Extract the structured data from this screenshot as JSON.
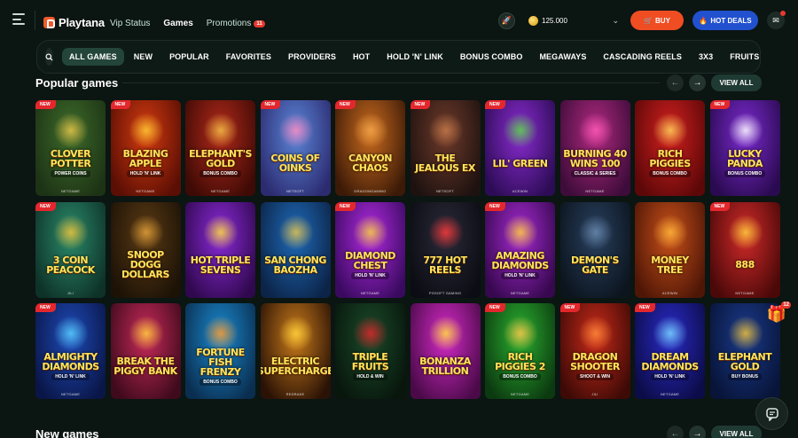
{
  "header": {
    "logo_text": "Playtana",
    "nav": [
      {
        "label": "Vip Status"
      },
      {
        "label": "Games"
      },
      {
        "label": "Promotions",
        "badge": "11"
      }
    ],
    "balance": "125.000",
    "buy_label": "BUY",
    "deals_label": "HOT DEALS",
    "icons": {
      "menu": "hamburger-menu-icon",
      "rocket": "rocket-icon",
      "mail": "mail-icon",
      "chevron": "chevron-down-icon"
    }
  },
  "categories": [
    "ALL GAMES",
    "NEW",
    "POPULAR",
    "FAVORITES",
    "PROVIDERS",
    "HOT",
    "HOLD 'N' LINK",
    "BONUS COMBO",
    "MEGAWAYS",
    "CASCADING REELS",
    "3X3",
    "FRUITS"
  ],
  "popular": {
    "title": "Popular games",
    "view_all": "VIEW ALL"
  },
  "new_games": {
    "title": "New games",
    "view_all": "VIEW ALL"
  },
  "new_badge": "NEW",
  "games": [
    {
      "title": "CLOVER POTTER",
      "sub": "POWER COINS",
      "provider": "NETGAME",
      "new": true,
      "bg1": "#3d6b2a",
      "bg2": "#1d3315",
      "blob": "#e9c64a"
    },
    {
      "title": "BLAZING APPLE",
      "sub": "HOLD 'N' LINK",
      "provider": "NETGAME",
      "new": true,
      "bg1": "#d43b10",
      "bg2": "#5a0e04",
      "blob": "#ffcc33"
    },
    {
      "title": "ELEPHANT'S GOLD",
      "sub": "BONUS COMBO",
      "provider": "NETGAME",
      "new": false,
      "bg1": "#b1291a",
      "bg2": "#3e0a05",
      "blob": "#f3c048"
    },
    {
      "title": "COINS OF OINKS",
      "sub": "",
      "provider": "NETSOFT",
      "new": true,
      "bg1": "#5b86d8",
      "bg2": "#2c2b70",
      "blob": "#ff8ac2"
    },
    {
      "title": "CANYON CHAOS",
      "sub": "",
      "provider": "DRAGONGAMING",
      "new": true,
      "bg1": "#c86a1e",
      "bg2": "#3c1a07",
      "blob": "#f2a64a"
    },
    {
      "title": "THE JEALOUS EX",
      "sub": "",
      "provider": "NETSOFT",
      "new": true,
      "bg1": "#6e3a2a",
      "bg2": "#1e1210",
      "blob": "#c47a4a"
    },
    {
      "title": "LIL' GREEN",
      "sub": "",
      "provider": "ACEWIN",
      "new": true,
      "bg1": "#8a2bd0",
      "bg2": "#2c0c55",
      "blob": "#59d845"
    },
    {
      "title": "BURNING 40 WINS 100",
      "sub": "CLASSIC & SERIES",
      "provider": "NETGAME",
      "new": false,
      "bg1": "#b12a80",
      "bg2": "#3e0c3a",
      "blob": "#ff5ab8"
    },
    {
      "title": "RICH PIGGIES",
      "sub": "BONUS COMBO",
      "provider": "",
      "new": false,
      "bg1": "#d2201f",
      "bg2": "#5c0708",
      "blob": "#ffd45a"
    },
    {
      "title": "LUCKY PANDA",
      "sub": "BONUS COMBO",
      "provider": "",
      "new": true,
      "bg1": "#7b2ad0",
      "bg2": "#2a0a50",
      "blob": "#ffffff"
    },
    {
      "title": "3 COIN PEACOCK",
      "sub": "",
      "provider": "JILI",
      "new": true,
      "bg1": "#2a8a6a",
      "bg2": "#0e3228",
      "blob": "#f0c23a"
    },
    {
      "title": "SNOOP DOGG DOLLARS",
      "sub": "",
      "provider": "",
      "new": false,
      "bg1": "#5a3a14",
      "bg2": "#1c1206",
      "blob": "#e5a23a"
    },
    {
      "title": "HOT TRIPLE SEVENS",
      "sub": "",
      "provider": "",
      "new": false,
      "bg1": "#8a2ad8",
      "bg2": "#30084e",
      "blob": "#ffde3a"
    },
    {
      "title": "SAN CHONG BAOZHA",
      "sub": "",
      "provider": "",
      "new": false,
      "bg1": "#1e6ab8",
      "bg2": "#0c2448",
      "blob": "#e6c24a"
    },
    {
      "title": "DIAMOND CHEST",
      "sub": "HOLD 'N' LINK",
      "provider": "NETGAME",
      "new": true,
      "bg1": "#b02ae0",
      "bg2": "#3a0a60",
      "blob": "#f7d23a"
    },
    {
      "title": "777 HOT REELS",
      "sub": "",
      "provider": "PGSOFT GAMING",
      "new": false,
      "bg1": "#2a2a38",
      "bg2": "#0c0c14",
      "blob": "#ff3a3a"
    },
    {
      "title": "AMAZING DIAMONDS",
      "sub": "HOLD 'N' LINK",
      "provider": "NETGAME",
      "new": true,
      "bg1": "#a42ad0",
      "bg2": "#36084e",
      "blob": "#ffcf3a"
    },
    {
      "title": "DEMON'S GATE",
      "sub": "",
      "provider": "",
      "new": false,
      "bg1": "#28405e",
      "bg2": "#0c141e",
      "blob": "#6a8ab0"
    },
    {
      "title": "MONEY TREE",
      "sub": "",
      "provider": "ACEWIN",
      "new": false,
      "bg1": "#c8501a",
      "bg2": "#4e1606",
      "blob": "#ffb63a"
    },
    {
      "title": "888",
      "sub": "",
      "provider": "NETGAME",
      "new": true,
      "bg1": "#d02a2a",
      "bg2": "#4a0808",
      "blob": "#ffd03a"
    },
    {
      "title": "ALMIGHTY DIAMONDS",
      "sub": "HOLD 'N' LINK",
      "provider": "NETGAME",
      "new": true,
      "bg1": "#1e4ab8",
      "bg2": "#0a1648",
      "blob": "#5ad0ff"
    },
    {
      "title": "BREAK THE PIGGY BANK",
      "sub": "",
      "provider": "",
      "new": false,
      "bg1": "#c82a5a",
      "bg2": "#3e0a1c",
      "blob": "#ffcf3a"
    },
    {
      "title": "FORTUNE FISH FRENZY",
      "sub": "BONUS COMBO",
      "provider": "",
      "new": false,
      "bg1": "#1a8ad0",
      "bg2": "#0a2e50",
      "blob": "#ff9a2a"
    },
    {
      "title": "ELECTRIC SUPERCHARGE",
      "sub": "",
      "provider": "REDRAKE",
      "new": false,
      "bg1": "#c87a1a",
      "bg2": "#2a1206",
      "blob": "#ffd23a"
    },
    {
      "title": "TRIPLE FRUITS",
      "sub": "HOLD & WIN",
      "provider": "",
      "new": false,
      "bg1": "#1a4a2a",
      "bg2": "#08160c",
      "blob": "#e0252a"
    },
    {
      "title": "BONANZA TRILLION",
      "sub": "",
      "provider": "",
      "new": false,
      "bg1": "#d42ac8",
      "bg2": "#4a0a48",
      "blob": "#ffdf3a"
    },
    {
      "title": "RICH PIGGIES 2",
      "sub": "BONUS COMBO",
      "provider": "NETGAME",
      "new": true,
      "bg1": "#2ab030",
      "bg2": "#0c3a10",
      "blob": "#ffc44a"
    },
    {
      "title": "DRAGON SHOOTER",
      "sub": "SHOOT & WIN",
      "provider": "JILI",
      "new": true,
      "bg1": "#c82a1a",
      "bg2": "#3e0a06",
      "blob": "#ff8a3a"
    },
    {
      "title": "DREAM DIAMONDS",
      "sub": "HOLD 'N' LINK",
      "provider": "NETGAME",
      "new": true,
      "bg1": "#2a2ac8",
      "bg2": "#0c0c48",
      "blob": "#7ad8ff"
    },
    {
      "title": "ELEPHANT GOLD",
      "sub": "BUY BONUS",
      "provider": "",
      "new": false,
      "bg1": "#1a3a8a",
      "bg2": "#081438",
      "blob": "#f0c23a"
    }
  ],
  "gift_count": "12"
}
